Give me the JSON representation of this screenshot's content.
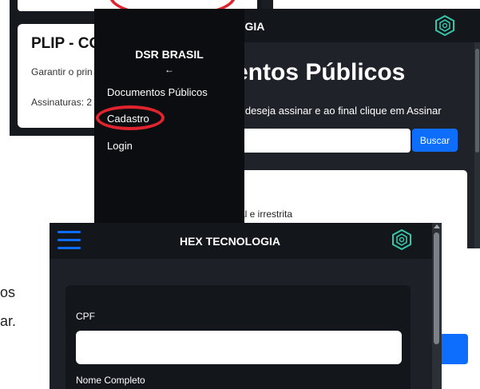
{
  "back_card": {
    "title": "PLIP - CO",
    "text": "Garantir o prin",
    "signatures": "Assinaturas: 2"
  },
  "documents_page": {
    "brand": "TECNOLOGIA",
    "heading": "entos Públicos",
    "subtitle": "e deseja assinar e ao final clique em Assinar",
    "search_placeholder": "",
    "search_button": "Buscar",
    "doc_text": "al e irrestrita"
  },
  "sidebar": {
    "title": "DSR BRASIL",
    "close": "←",
    "items": [
      {
        "label": "Documentos Públicos"
      },
      {
        "label": "Cadastro"
      },
      {
        "label": "Login"
      }
    ]
  },
  "left_fragments": {
    "line1": "os",
    "line2": "ar."
  },
  "cadastro_page": {
    "brand": "HEX TECNOLOGIA",
    "fields": [
      {
        "label": "CPF",
        "value": ""
      },
      {
        "label": "Nome Completo"
      }
    ]
  },
  "colors": {
    "accent_blue": "#0d6efd",
    "highlight_red": "#e0242e",
    "logo_teal": "#38c6a8",
    "dark_bg": "#1d2127"
  },
  "icons": [
    "hexagon-logo-icon",
    "hamburger-menu-icon",
    "back-arrow-icon"
  ]
}
